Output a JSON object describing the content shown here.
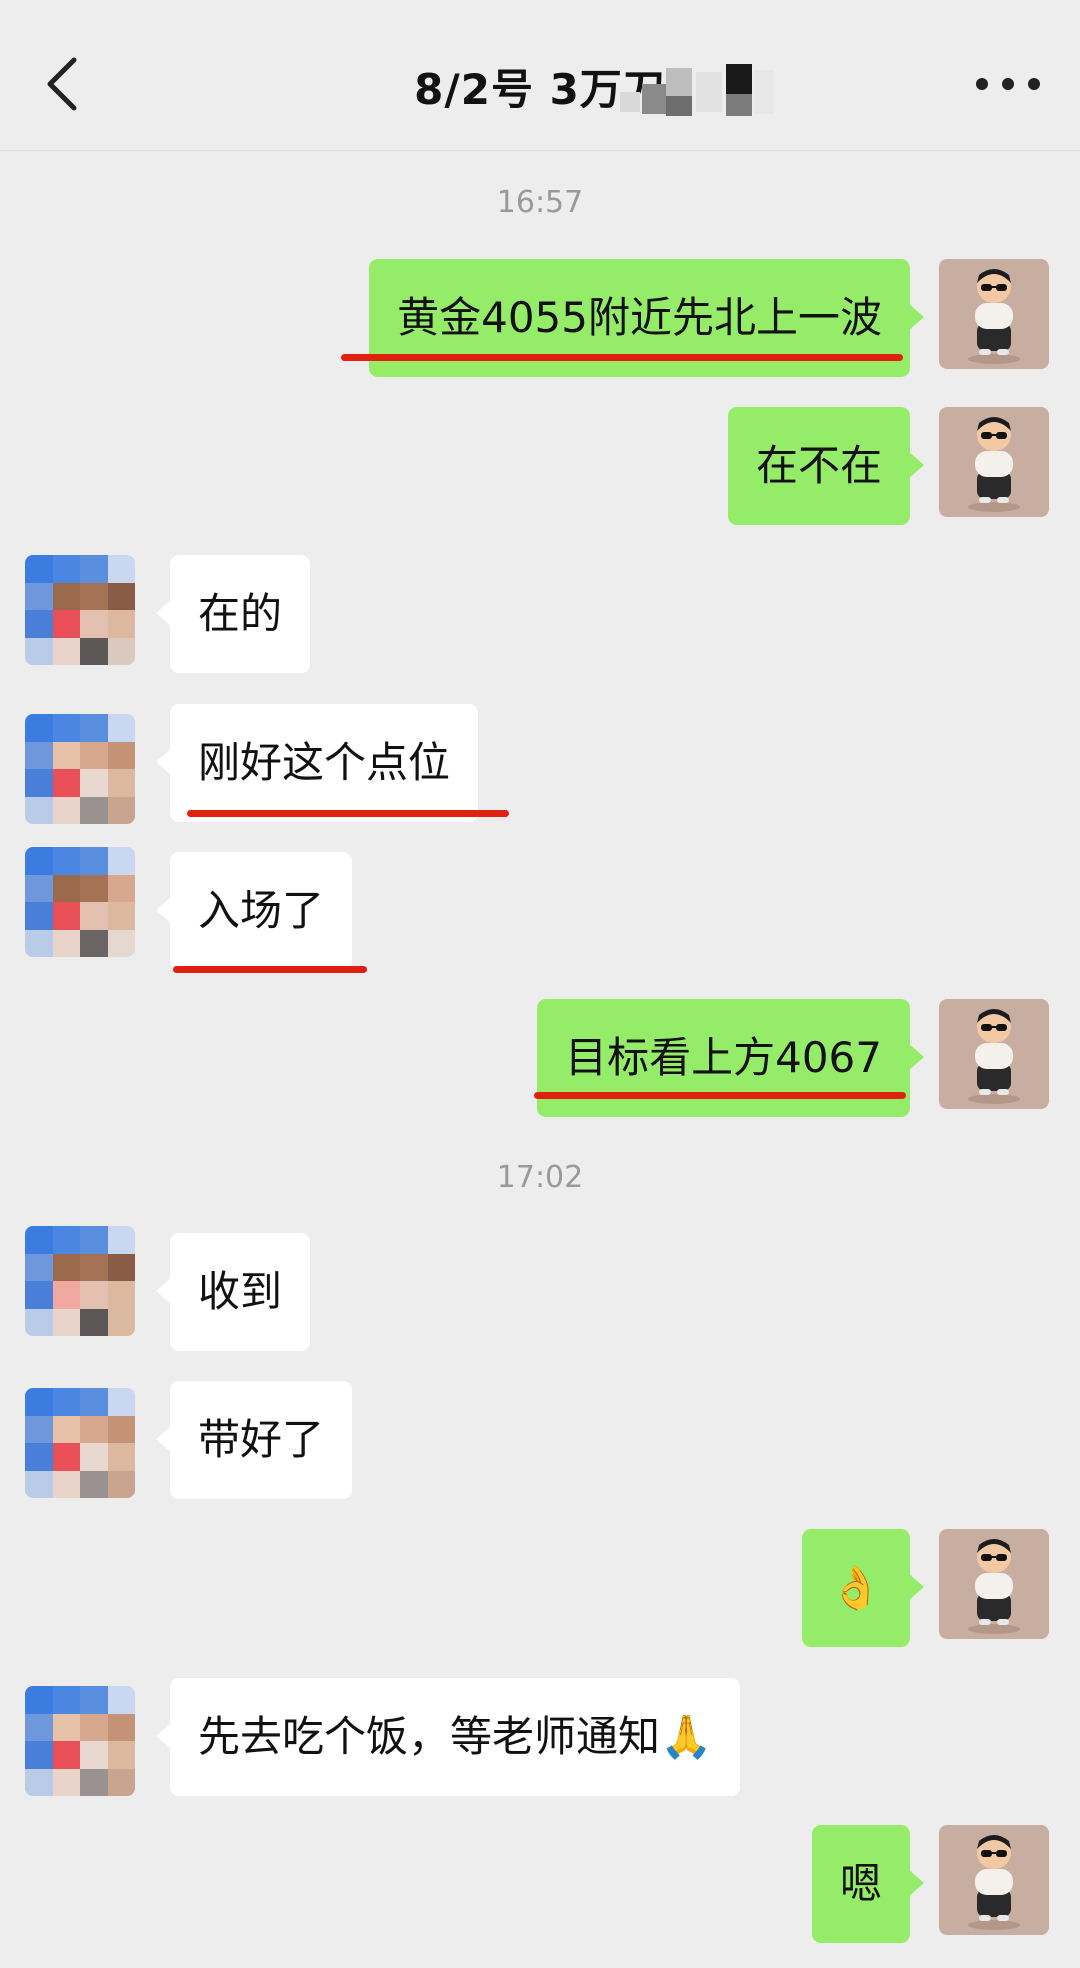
{
  "header": {
    "title": "8/2号  3万刀"
  },
  "timestamps": [
    "16:57",
    "17:02"
  ],
  "messages": [
    {
      "side": "self",
      "text": "黄金4055附近先北上一波",
      "underlined": true
    },
    {
      "side": "self",
      "text": "在不在",
      "underlined": false
    },
    {
      "side": "other",
      "text": "在的",
      "underlined": false
    },
    {
      "side": "other",
      "text": "刚好这个点位",
      "underlined": true
    },
    {
      "side": "other",
      "text": "入场了",
      "underlined": true
    },
    {
      "side": "self",
      "text": "目标看上方4067",
      "underlined": true
    },
    {
      "side": "other",
      "text": "收到",
      "underlined": false
    },
    {
      "side": "other",
      "text": "带好了",
      "underlined": false
    },
    {
      "side": "self",
      "text": "👌",
      "underlined": false
    },
    {
      "side": "other",
      "text": "先去吃个饭，等老师通知🙏",
      "underlined": false
    },
    {
      "side": "self",
      "text": "嗯",
      "underlined": false
    }
  ],
  "colors": {
    "background": "#ededed",
    "self_bubble": "#95ec69",
    "other_bubble": "#ffffff",
    "underline": "#e0210f"
  },
  "icons": [
    "back-arrow-icon",
    "more-dots-icon"
  ]
}
